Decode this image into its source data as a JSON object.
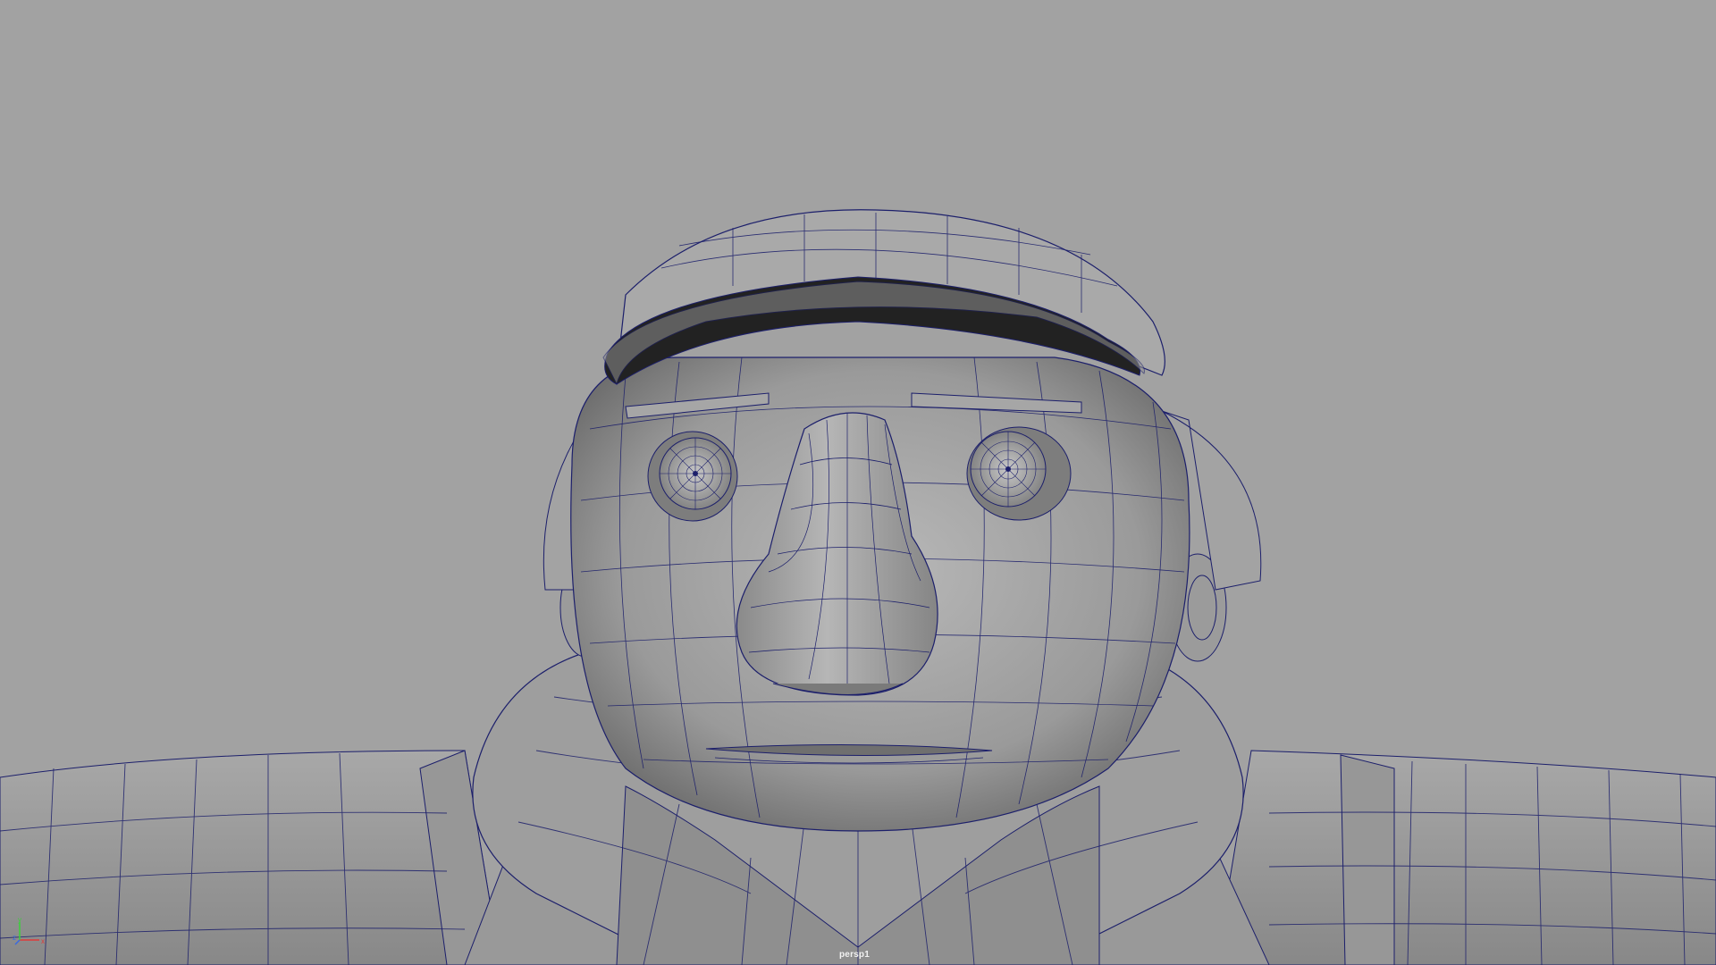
{
  "viewport": {
    "camera_name": "persp1",
    "background_color": "#a2a2a2",
    "wire_color": "#1c1f6b",
    "mesh_color": "#9c9c9c",
    "display_mode": "wireframe-on-shaded"
  },
  "axis_gizmo": {
    "x_label": "x",
    "y_label": "y",
    "z_label": "z",
    "x_color": "#e03a3a",
    "y_color": "#3ad03a",
    "z_color": "#3a6ae0"
  },
  "model": {
    "icon": "character-mesh-icon"
  }
}
